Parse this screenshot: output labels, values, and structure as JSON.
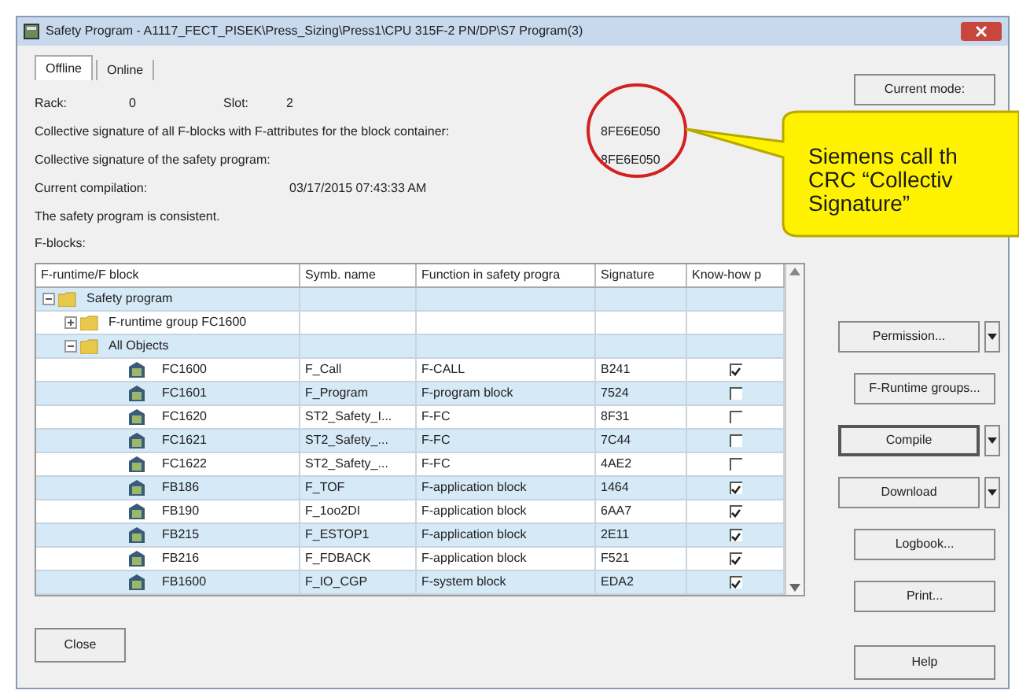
{
  "window": {
    "title": "Safety Program - A1117_FECT_PISEK\\Press_Sizing\\Press1\\CPU 315F-2 PN/DP\\S7 Program(3)"
  },
  "tabs": [
    {
      "label": "Offline",
      "selected": true
    },
    {
      "label": "Online",
      "selected": false
    }
  ],
  "rack": {
    "label": "Rack:",
    "value": "0"
  },
  "slot": {
    "label": "Slot:",
    "value": "2"
  },
  "info": [
    {
      "label": "Collective signature of all F-blocks with F-attributes for the block container:",
      "value": "8FE6E050"
    },
    {
      "label": "Collective signature of the safety program:",
      "value": "8FE6E050"
    },
    {
      "label": "Current compilation:",
      "value": "03/17/2015 07:43:33 AM"
    }
  ],
  "status": "The safety program is consistent.",
  "fblocks_label": "F-blocks:",
  "table": {
    "columns": [
      "F-runtime/F block",
      "Symb. name",
      "Function in safety progra",
      "Signature",
      "Know-how p"
    ],
    "rows": [
      {
        "label": "Safety program",
        "expanded": true,
        "children": [
          {
            "label": "F-runtime group FC1600",
            "expanded": false
          },
          {
            "label": "All Objects",
            "expanded": true,
            "children": [
              {
                "label": "FC1600",
                "symbol": "F_Call",
                "function": "F-CALL",
                "signature": "B241",
                "know_how": true
              },
              {
                "label": "FC1601",
                "symbol": "F_Program",
                "function": "F-program block",
                "signature": "7524",
                "know_how": false
              },
              {
                "label": "FC1620",
                "symbol": "ST2_Safety_I...",
                "function": "F-FC",
                "signature": "8F31",
                "know_how": false
              },
              {
                "label": "FC1621",
                "symbol": "ST2_Safety_...",
                "function": "F-FC",
                "signature": "7C44",
                "know_how": false
              },
              {
                "label": "FC1622",
                "symbol": "ST2_Safety_...",
                "function": "F-FC",
                "signature": "4AE2",
                "know_how": false
              },
              {
                "label": "FB186",
                "symbol": "F_TOF",
                "function": "F-application block",
                "signature": "1464",
                "know_how": true
              },
              {
                "label": "FB190",
                "symbol": "F_1oo2DI",
                "function": "F-application block",
                "signature": "6AA7",
                "know_how": true
              },
              {
                "label": "FB215",
                "symbol": "F_ESTOP1",
                "function": "F-application block",
                "signature": "2E11",
                "know_how": true
              },
              {
                "label": "FB216",
                "symbol": "F_FDBACK",
                "function": "F-application block",
                "signature": "F521",
                "know_how": true
              },
              {
                "label": "FB1600",
                "symbol": "F_IO_CGP",
                "function": "F-system block",
                "signature": "EDA2",
                "know_how": true
              }
            ]
          }
        ]
      }
    ]
  },
  "side_buttons": [
    {
      "label": "Current mode:",
      "dropdown": false,
      "focused": false
    },
    {
      "label": "Permission...",
      "dropdown": true,
      "focused": false
    },
    {
      "label": "F-Runtime groups...",
      "dropdown": false,
      "focused": false
    },
    {
      "label": "Compile",
      "dropdown": true,
      "focused": true
    },
    {
      "label": "Download",
      "dropdown": true,
      "focused": false
    },
    {
      "label": "Logbook...",
      "dropdown": false,
      "focused": false
    },
    {
      "label": "Print...",
      "dropdown": false,
      "focused": false
    }
  ],
  "close_button": "Close",
  "help_button": "Help",
  "callout": {
    "lines": [
      "Siemens call th",
      "CRC “Collectiv",
      "Signature”"
    ]
  }
}
